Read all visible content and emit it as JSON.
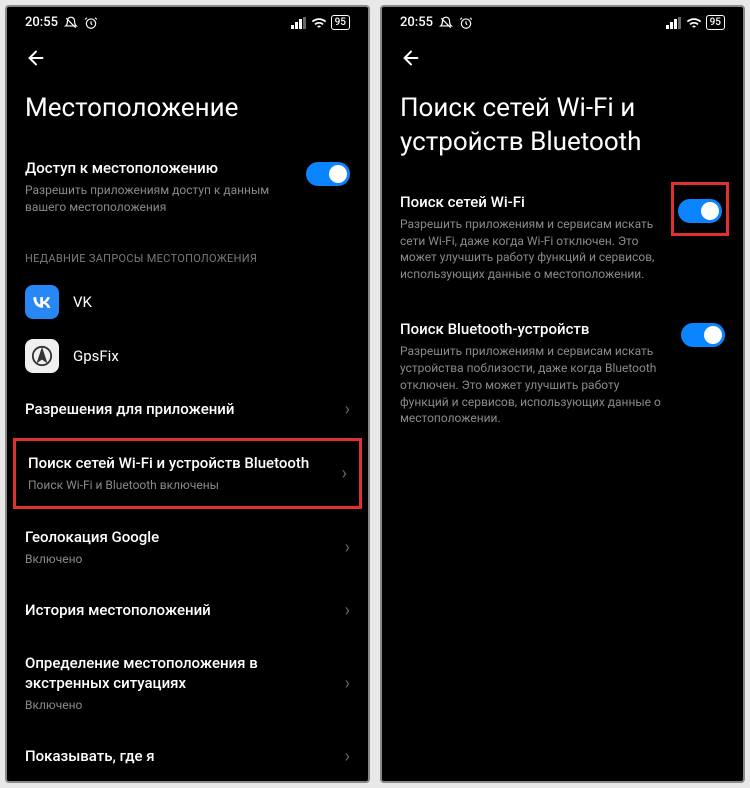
{
  "status": {
    "time": "20:55",
    "battery": "95"
  },
  "screen1": {
    "title": "Местоположение",
    "location_access": {
      "title": "Доступ к местоположению",
      "desc": "Разрешить приложениям доступ к данным вашего местоположения"
    },
    "recent_header": "НЕДАВНИЕ ЗАПРОСЫ МЕСТОПОЛОЖЕНИЯ",
    "apps": {
      "vk": "VK",
      "gpsfix": "GpsFix"
    },
    "app_permissions": "Разрешения для приложений",
    "wifi_bt_scan": {
      "title": "Поиск сетей Wi-Fi и устройств Bluetooth",
      "desc": "Поиск Wi-Fi и Bluetooth включены"
    },
    "google_location": {
      "title": "Геолокация Google",
      "desc": "Включено"
    },
    "location_history": "История местоположений",
    "emergency_location": {
      "title": "Определение местоположения в экстренных ситуациях",
      "desc": "Включено"
    },
    "show_where": "Показывать, где я"
  },
  "screen2": {
    "title": "Поиск сетей Wi-Fi и устройств Bluetooth",
    "wifi_scan": {
      "title": "Поиск сетей Wi-Fi",
      "desc": "Разрешить приложениям и сервисам искать сети Wi-Fi, даже когда Wi-Fi отключен. Это может улучшить работу функций и сервисов, использующих данные о местоположении."
    },
    "bt_scan": {
      "title": "Поиск Bluetooth-устройств",
      "desc": "Разрешить приложениям и сервисам искать устройства поблизости, даже когда Bluetooth отключен. Это может улучшить работу функций и сервисов, использующих данные о местоположении."
    }
  }
}
